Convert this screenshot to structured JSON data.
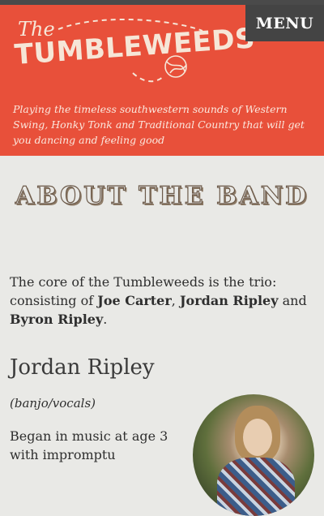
{
  "header": {
    "logo_the": "The",
    "logo_main": "TUMBLEWEEDS",
    "menu_label": "MENU",
    "tagline": "Playing the timeless southwestern sounds of Western Swing, Honky Tonk and Traditional Country that will get you dancing and feeling good",
    "colors": {
      "header_bg": "#e8503a",
      "menu_bg": "#444444",
      "logo": "#f6e6d7"
    }
  },
  "main": {
    "title": "ABOUT THE BAND",
    "intro": {
      "prefix": "The core of the Tumbleweeds is the trio: consisting of ",
      "member1": "Joe Carter",
      "sep1": ", ",
      "member2": "Jordan Ripley",
      "sep2": " and ",
      "member3": "Byron Ripley",
      "suffix": "."
    },
    "member": {
      "name": "Jordan Ripley",
      "role": "(banjo/vocals)",
      "bio": "Began in music at age 3 with impromptu"
    }
  }
}
